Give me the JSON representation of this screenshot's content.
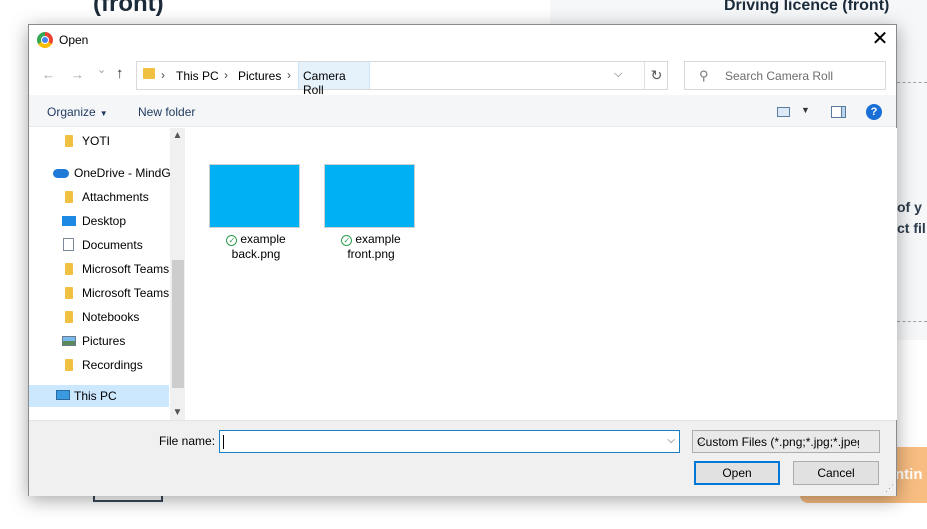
{
  "background": {
    "left_title": "(front)",
    "right_title": "Driving licence (front)",
    "fragment1": "of y",
    "fragment2": "ct fil",
    "button_fragment": "ntin"
  },
  "dialog": {
    "title": "Open",
    "close_glyph": "✕"
  },
  "nav": {
    "back_glyph": "←",
    "forward_glyph": "→",
    "recent_glyph": "⌄",
    "up_glyph": "↑",
    "breadcrumb": [
      "This PC",
      "Pictures",
      "Camera Roll"
    ],
    "separator": "›",
    "dropdown_glyph": "⌵",
    "refresh_glyph": "↻"
  },
  "search": {
    "placeholder": "Search Camera Roll",
    "icon_glyph": "⚲"
  },
  "toolbar": {
    "organize_label": "Organize",
    "caret": "▼",
    "new_folder_label": "New folder",
    "view_caret": "▼",
    "help_glyph": "?"
  },
  "sidebar": {
    "scroll_up": "▲",
    "scroll_down": "▼",
    "items": [
      {
        "label": "YOTI"
      },
      {
        "label": "OneDrive - MindG"
      },
      {
        "label": "Attachments"
      },
      {
        "label": "Desktop"
      },
      {
        "label": "Documents"
      },
      {
        "label": "Microsoft Teams"
      },
      {
        "label": "Microsoft Teams"
      },
      {
        "label": "Notebooks"
      },
      {
        "label": "Pictures"
      },
      {
        "label": "Recordings"
      },
      {
        "label": "This PC"
      }
    ]
  },
  "files": [
    {
      "line1": "example",
      "line2": "back.png",
      "thumb_color": "#00b0f5"
    },
    {
      "line1": "example",
      "line2": "front.png",
      "thumb_color": "#00b0f5"
    }
  ],
  "sync_glyph": "✓",
  "footer": {
    "file_name_label": "File name:",
    "file_name_value": "",
    "file_type": "Custom Files (*.png;*.jpg;*.jpeg",
    "dropdown_glyph": "⌵",
    "open_label": "Open",
    "cancel_label": "Cancel",
    "grip_glyph": "⋰"
  },
  "colors": {
    "accent": "#0078d7",
    "thumbnail": "#00b0f5",
    "selection": "#cce8ff"
  }
}
